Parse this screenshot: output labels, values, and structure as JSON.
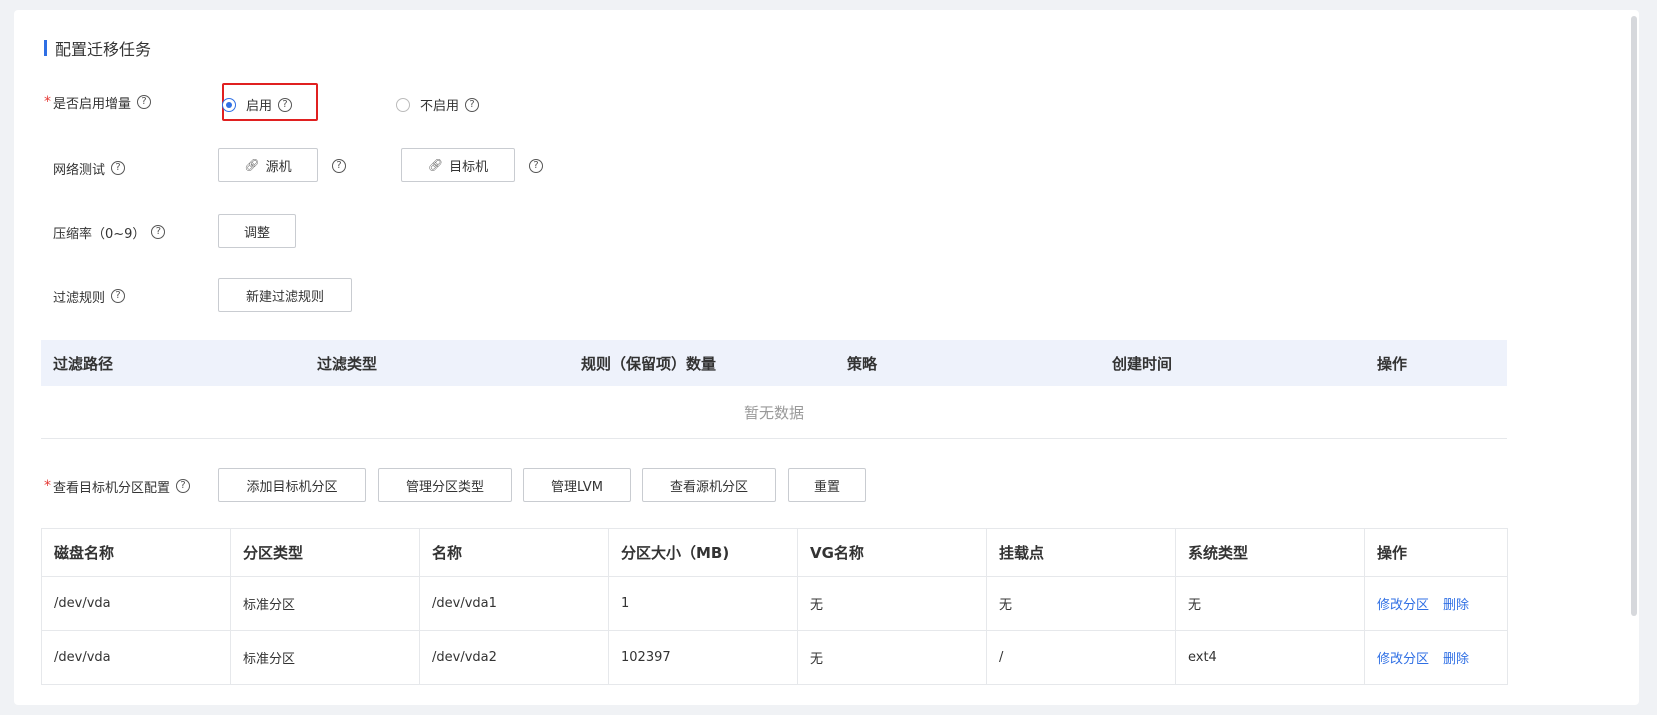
{
  "section": {
    "title": "配置迁移任务"
  },
  "incremental": {
    "label": "是否启用增量",
    "required_mark": "*",
    "options": [
      {
        "label": "启用",
        "selected": true
      },
      {
        "label": "不启用",
        "selected": false
      }
    ]
  },
  "network_test": {
    "label": "网络测试",
    "source_button": "源机",
    "target_button": "目标机"
  },
  "compression": {
    "label": "压缩率（0~9）",
    "adjust_button": "调整"
  },
  "filter_rules": {
    "label": "过滤规则",
    "new_button": "新建过滤规则",
    "columns": [
      "过滤路径",
      "过滤类型",
      "规则（保留项）数量",
      "策略",
      "创建时间",
      "操作"
    ],
    "empty_text": "暂无数据"
  },
  "partition": {
    "label": "查看目标机分区配置",
    "required_mark": "*",
    "buttons": [
      "添加目标机分区",
      "管理分区类型",
      "管理LVM",
      "查看源机分区",
      "重置"
    ],
    "columns": [
      "磁盘名称",
      "分区类型",
      "名称",
      "分区大小（MB)",
      "VG名称",
      "挂载点",
      "系统类型",
      "操作"
    ],
    "rows": [
      {
        "disk": "/dev/vda",
        "type": "标准分区",
        "name": "/dev/vda1",
        "size": "1",
        "vg": "无",
        "mount": "无",
        "fs": "无",
        "actions": [
          "修改分区",
          "删除"
        ]
      },
      {
        "disk": "/dev/vda",
        "type": "标准分区",
        "name": "/dev/vda2",
        "size": "102397",
        "vg": "无",
        "mount": "/",
        "fs": "ext4",
        "actions": [
          "修改分区",
          "删除"
        ]
      }
    ]
  },
  "icons": {
    "help": "question-circle-icon",
    "link": "link-icon"
  },
  "colors": {
    "accent": "#2f6fe4",
    "required": "#e53935",
    "highlight": "#e02020",
    "table_header_bg": "#eef2fb"
  }
}
